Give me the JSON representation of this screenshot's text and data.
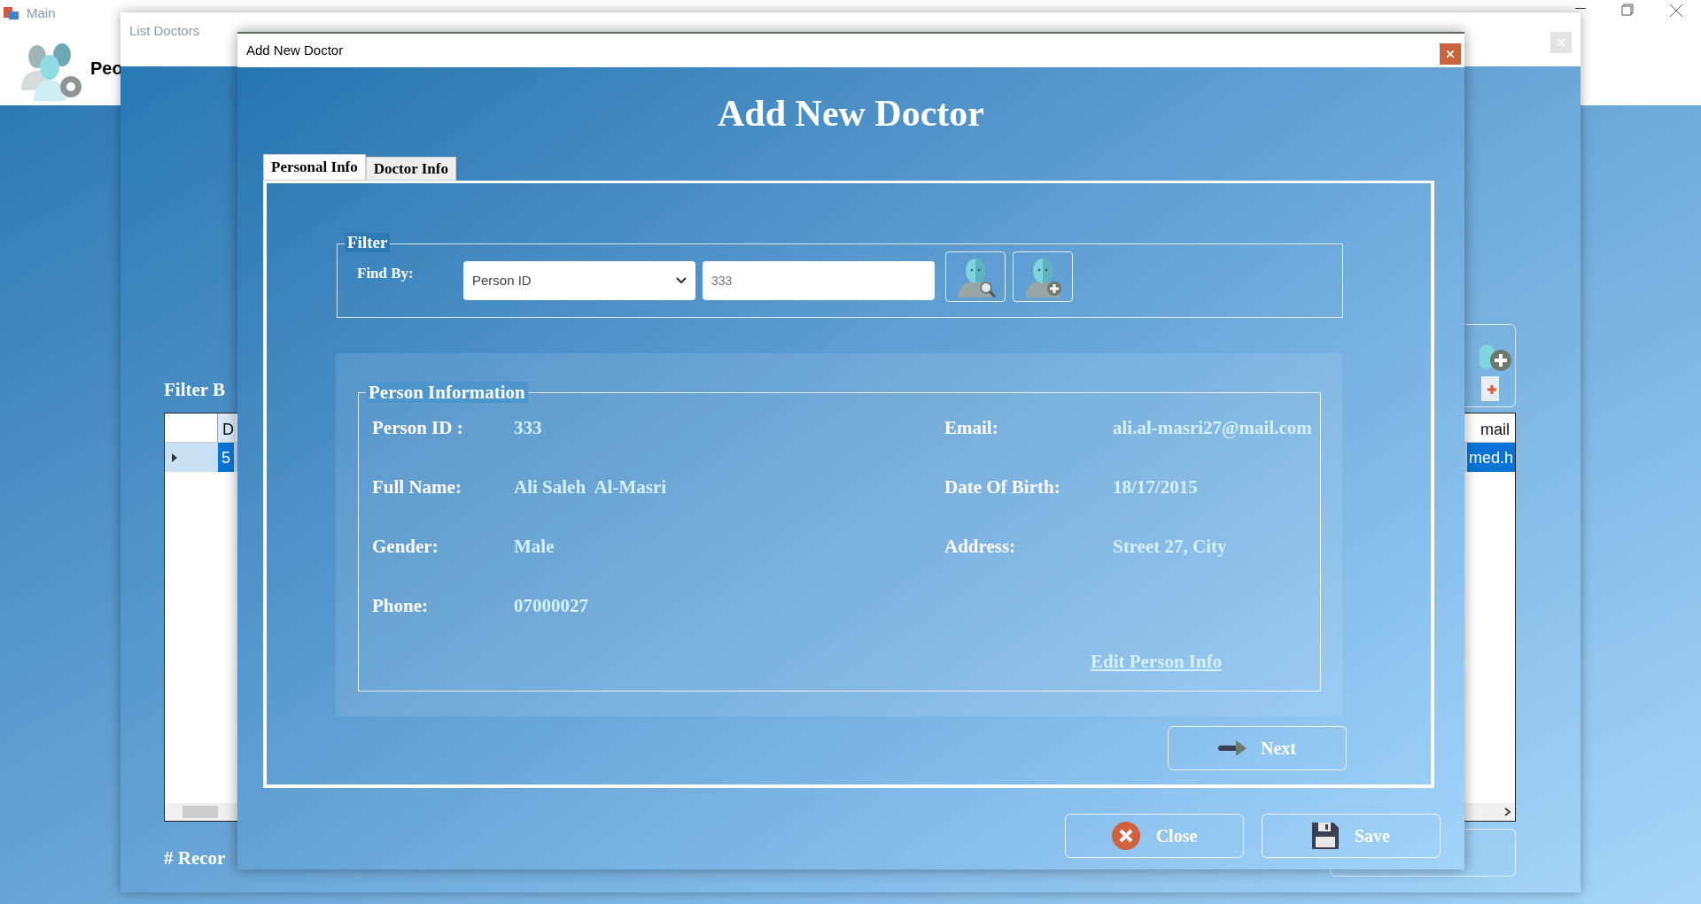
{
  "main_window": {
    "title": "Main",
    "header_label": "Peo"
  },
  "list_window": {
    "title": "List Doctors",
    "filter_label": "Filter B",
    "grid": {
      "columns": [
        "D",
        "mail"
      ],
      "rows": [
        {
          "cells": [
            "5",
            "med.h"
          ],
          "selected": true
        }
      ]
    },
    "records_label": "# Recor"
  },
  "dialog": {
    "title": "Add New Doctor",
    "heading": "Add New Doctor",
    "tabs": [
      {
        "label": "Personal Info",
        "selected": true
      },
      {
        "label": "Doctor Info",
        "selected": false
      }
    ],
    "filter": {
      "legend": "Filter",
      "find_by_label": "Find By:",
      "find_by_value": "Person ID",
      "search_value": "333"
    },
    "person_info": {
      "legend": "Person Information",
      "rows": [
        {
          "left": {
            "label": "Person ID :",
            "value": "333"
          },
          "right": {
            "label": "Email:",
            "value": "ali.al-masri27@mail.com"
          }
        },
        {
          "left": {
            "label": "Full Name:",
            "value": "Ali Saleh  Al-Masri"
          },
          "right": {
            "label": "Date Of Birth:",
            "value": "18/17/2015"
          }
        },
        {
          "left": {
            "label": "Gender:",
            "value": "Male"
          },
          "right": {
            "label": "Address:",
            "value": "Street 27, City"
          }
        },
        {
          "left": {
            "label": "Phone:",
            "value": "07000027"
          }
        }
      ],
      "edit_link": "Edit Person Info"
    },
    "next_button": "Next",
    "buttons": [
      {
        "kind": "close",
        "label": "Close"
      },
      {
        "kind": "save",
        "label": "Save"
      }
    ]
  }
}
